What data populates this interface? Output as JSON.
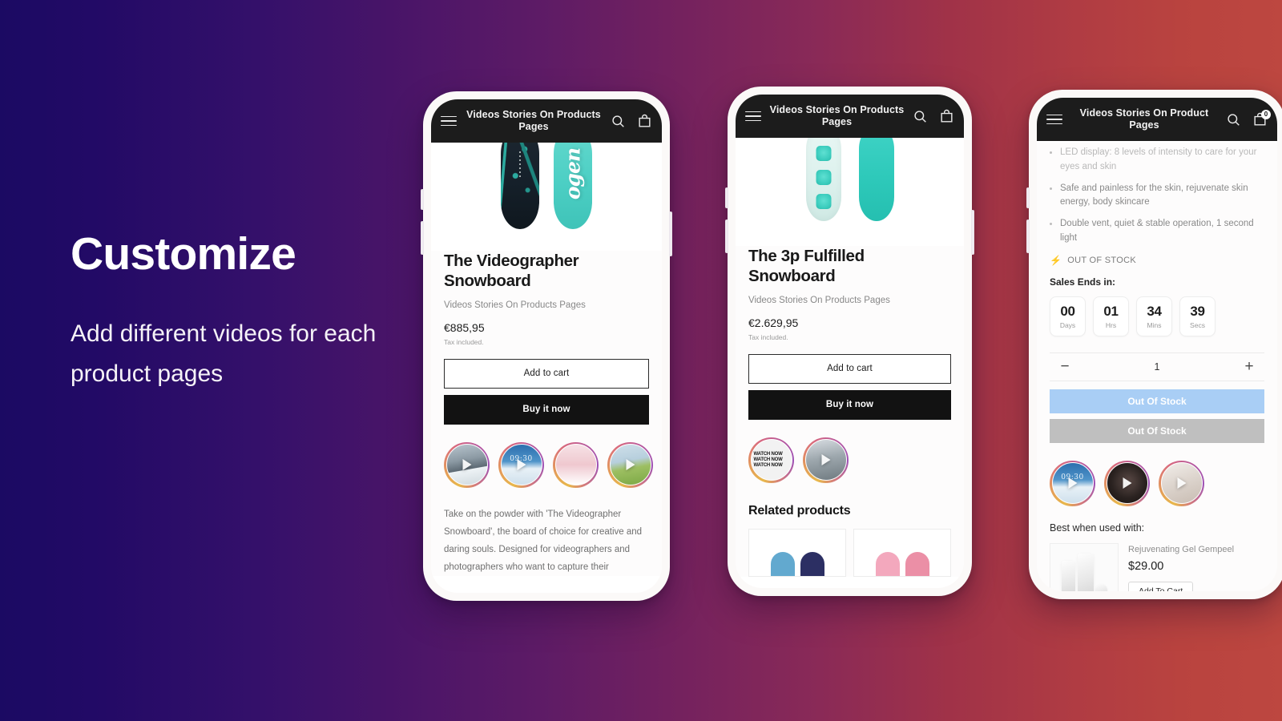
{
  "promo": {
    "title": "Customize",
    "subtitle": "Add different videos for each product pages"
  },
  "phones": [
    {
      "header": {
        "title": "Videos Stories On Products Pages",
        "menu_icon": "hamburger-icon",
        "search_icon": "search-icon",
        "cart_icon": "shopping-bag-icon"
      },
      "product": {
        "title": "The Videographer Snowboard",
        "vendor": "Videos Stories On Products Pages",
        "price": "€885,95",
        "tax_note": "Tax included.",
        "add_to_cart": "Add to cart",
        "buy_now": "Buy it now",
        "description": "Take on the powder with 'The Videographer Snowboard', the board of choice for creative and daring souls. Designed for videographers and photographers who want to capture their"
      },
      "stories": [
        {
          "label": "",
          "art": "th-mtn"
        },
        {
          "label": "09:30",
          "art": "th-snow"
        },
        {
          "label": "",
          "art": "th-pink"
        },
        {
          "label": "",
          "art": "th-field"
        }
      ]
    },
    {
      "header": {
        "title": "Videos Stories On Products Pages",
        "menu_icon": "hamburger-icon",
        "search_icon": "search-icon",
        "cart_icon": "shopping-bag-icon"
      },
      "product": {
        "title": "The 3p Fulfilled Snowboard",
        "vendor": "Videos Stories On Products Pages",
        "price": "€2.629,95",
        "tax_note": "Tax included.",
        "add_to_cart": "Add to cart",
        "buy_now": "Buy it now"
      },
      "stories": [
        {
          "label": "WATCH NOW",
          "art": "th-watch"
        },
        {
          "label": "",
          "art": "th-fam"
        }
      ],
      "related": {
        "heading": "Related products"
      }
    },
    {
      "header": {
        "title": "Videos Stories On Product Pages",
        "menu_icon": "hamburger-icon",
        "search_icon": "search-icon",
        "cart_icon": "shopping-bag-icon",
        "cart_count": "0"
      },
      "bullets": [
        "LED display: 8 levels of intensity to care for your eyes and skin",
        "Safe and painless for the skin, rejuvenate skin energy, body skincare",
        "Double vent, quiet & stable operation, 1 second light"
      ],
      "stock_status": "OUT OF STOCK",
      "sales_label": "Sales Ends in:",
      "countdown": [
        {
          "value": "00",
          "unit": "Days"
        },
        {
          "value": "01",
          "unit": "Hrs"
        },
        {
          "value": "34",
          "unit": "Mins"
        },
        {
          "value": "39",
          "unit": "Secs"
        }
      ],
      "quantity": {
        "decrement": "−",
        "value": "1",
        "increment": "+"
      },
      "actions": {
        "primary": "Out Of Stock",
        "secondary": "Out Of Stock"
      },
      "stories": [
        {
          "label": "09:30",
          "art": "th-snow"
        },
        {
          "label": "",
          "art": "th-dark"
        },
        {
          "label": "",
          "art": "th-room"
        }
      ],
      "best_with": {
        "label": "Best when used with:",
        "item_name": "Rejuvenating Gel Gempeel",
        "item_price": "$29.00",
        "add_button": "Add To Cart"
      }
    }
  ],
  "colors": {
    "gradient_start": "#1b0a63",
    "gradient_end": "#bd4740",
    "header_bar": "#1c1c1c",
    "buy_now": "#121212",
    "oos_primary": "#a9cef5",
    "oos_secondary": "#bfbfbf",
    "bolt": "#e0483f"
  }
}
